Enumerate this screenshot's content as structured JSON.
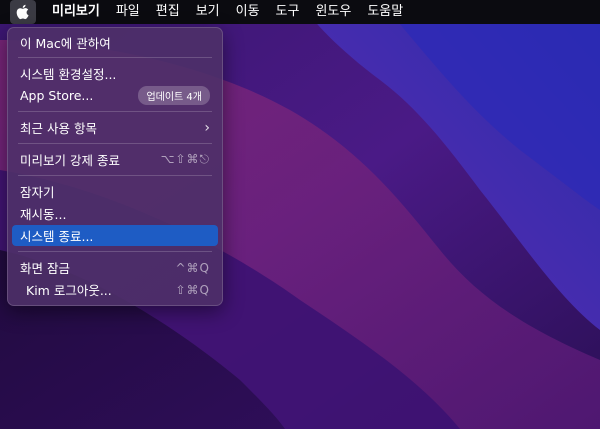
{
  "menubar": {
    "items": [
      "미리보기",
      "파일",
      "편집",
      "보기",
      "이동",
      "도구",
      "윈도우",
      "도움말"
    ]
  },
  "apple_menu": {
    "about": "이 Mac에 관하여",
    "settings": "시스템 환경설정...",
    "app_store": "App Store...",
    "update_badge": "업데이트 4개",
    "recent": "최근 사용 항목",
    "force_quit": "미리보기 강제 종료",
    "force_quit_shortcut": "⌥⇧⌘⎋",
    "sleep": "잠자기",
    "restart": "재시동...",
    "shutdown": "시스템 종료...",
    "lock": "화면 잠금",
    "lock_shortcut": "^⌘Q",
    "logout": "Kim 로그아웃...",
    "logout_shortcut": "⇧⌘Q"
  },
  "colors": {
    "menubar": "#0b0b10",
    "selection": "#1e5cc4",
    "wallpaper_dark": "#2a0f55",
    "wallpaper_accent": "#7a2a8a"
  },
  "icons": {
    "apple": "apple-logo-icon",
    "submenu": "chevron-right-icon"
  }
}
